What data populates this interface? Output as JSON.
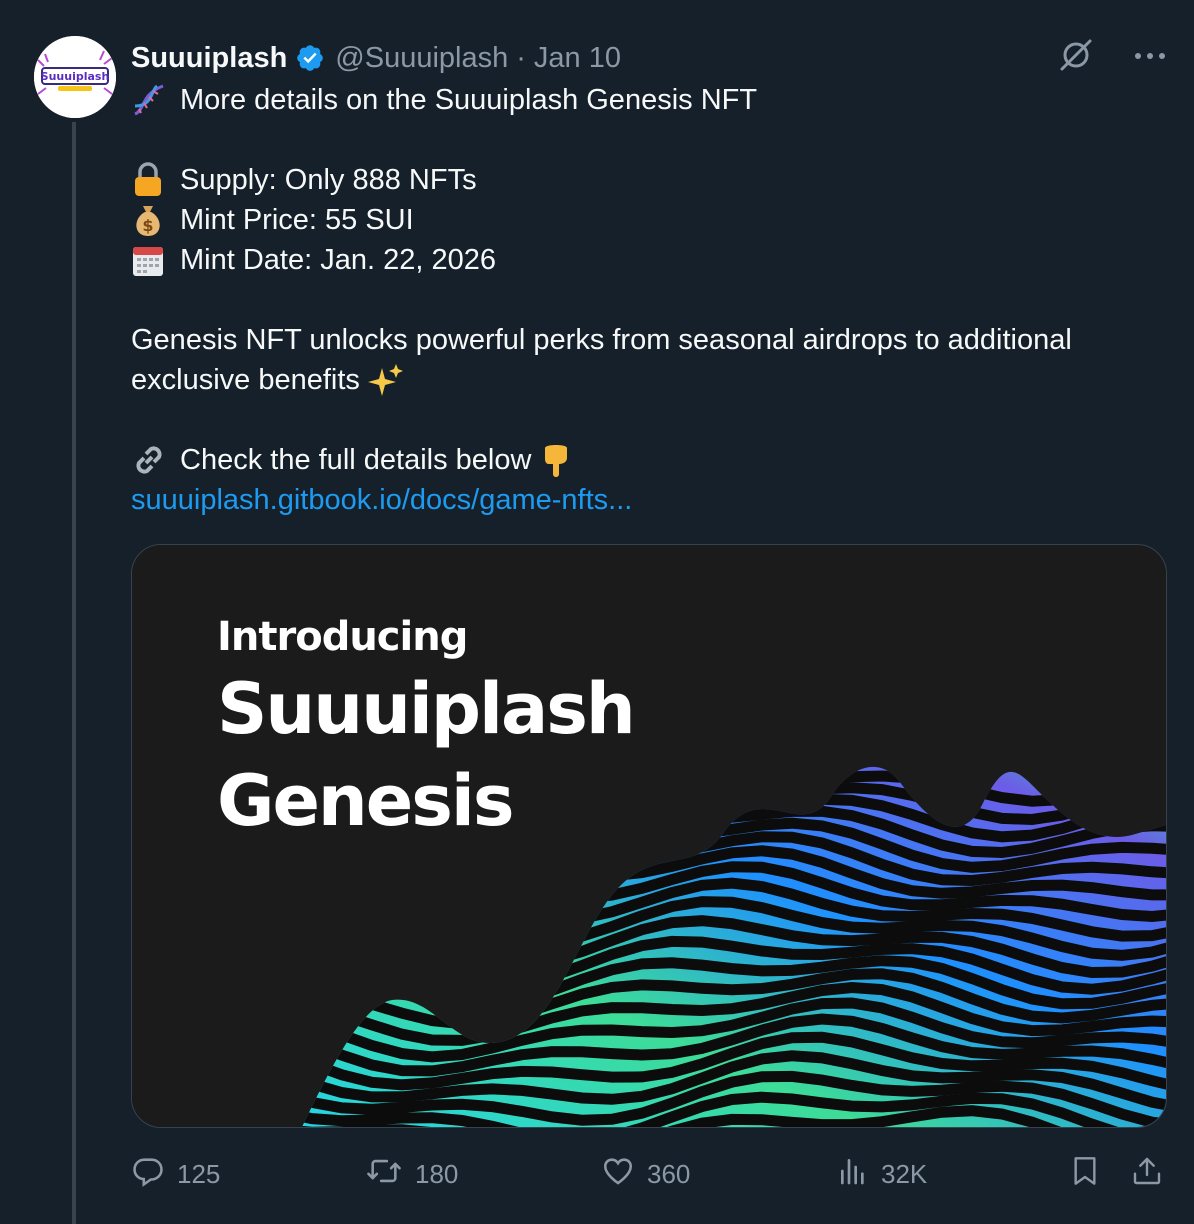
{
  "tweet": {
    "display_name": "Suuuiplash",
    "handle": "@Suuuiplash",
    "separator": "·",
    "date": "Jan 10",
    "avatar_logo_text": "Suuuiplash",
    "lines": {
      "intro": "More details on the Suuuiplash Genesis NFT",
      "supply": "Supply: Only 888 NFTs",
      "price": "Mint Price: 55 SUI",
      "date": "Mint Date: Jan. 22, 2026",
      "perks_1": "Genesis NFT unlocks powerful perks from seasonal airdrops to additional",
      "perks_2": "exclusive benefits",
      "check": "Check the full details below"
    },
    "link": "suuuiplash.gitbook.io/docs/game-nfts..."
  },
  "media": {
    "line1": "Introducing",
    "line2": "Suuuiplash",
    "line3": "Genesis"
  },
  "stats": {
    "replies": "125",
    "reposts": "180",
    "likes": "360",
    "views": "32K"
  },
  "icons": [
    "verified-badge-icon",
    "grok-icon",
    "more-icon",
    "dna-icon",
    "lock-icon",
    "money-bag-icon",
    "calendar-icon",
    "sparkles-icon",
    "link-icon",
    "pointing-down-icon",
    "reply-icon",
    "repost-icon",
    "like-icon",
    "views-icon",
    "bookmark-icon",
    "share-icon"
  ],
  "colors": {
    "background": "#15202b",
    "link": "#1d9bf0",
    "muted": "#8b98a5",
    "verified": "#1d9bf0"
  }
}
